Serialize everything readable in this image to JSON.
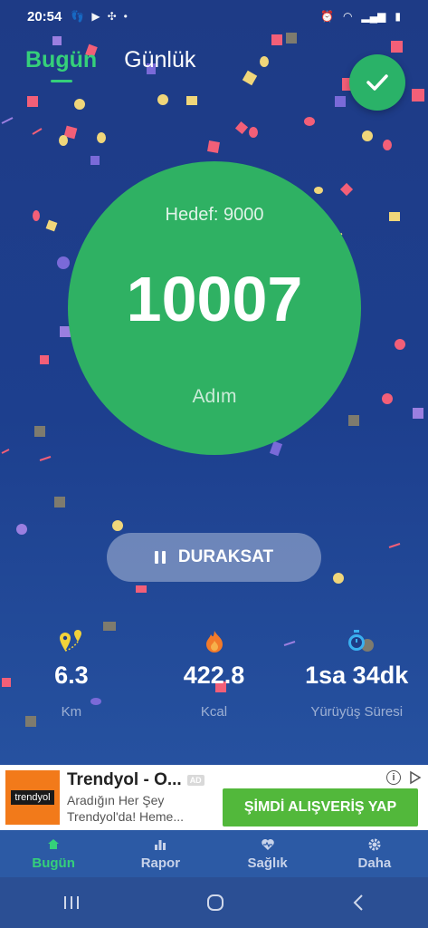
{
  "status_bar": {
    "time": "20:54"
  },
  "tabs": {
    "today": "Bugün",
    "daily": "Günlük"
  },
  "colors": {
    "accent": "#35d07a",
    "circle": "#2fb163",
    "background": "#1e3b86",
    "ad_cta": "#52b83b"
  },
  "progress": {
    "goal_text": "Hedef: 9000",
    "steps": "10007",
    "unit": "Adım"
  },
  "pause_button": {
    "label": "DURAKSAT",
    "icon": "pause-icon"
  },
  "stats": [
    {
      "icon": "location-pins-icon",
      "value": "6.3",
      "label": "Km"
    },
    {
      "icon": "flame-icon",
      "value": "422.8",
      "label": "Kcal"
    },
    {
      "icon": "stopwatch-icon",
      "value": "1sa 34dk",
      "label": "Yürüyüş Süresi"
    }
  ],
  "ad": {
    "logo_text": "trendyol",
    "title": "Trendyol - O...",
    "badge": "AD",
    "description": "Aradığın Her Şey Trendyol'da! Heme...",
    "cta": "ŞİMDİ ALIŞVERİŞ YAP"
  },
  "bottom_nav": [
    {
      "label": "Bugün",
      "icon": "home-icon",
      "active": true
    },
    {
      "label": "Rapor",
      "icon": "bar-chart-icon",
      "active": false
    },
    {
      "label": "Sağlık",
      "icon": "heart-pulse-icon",
      "active": false
    },
    {
      "label": "Daha",
      "icon": "gear-icon",
      "active": false
    }
  ]
}
